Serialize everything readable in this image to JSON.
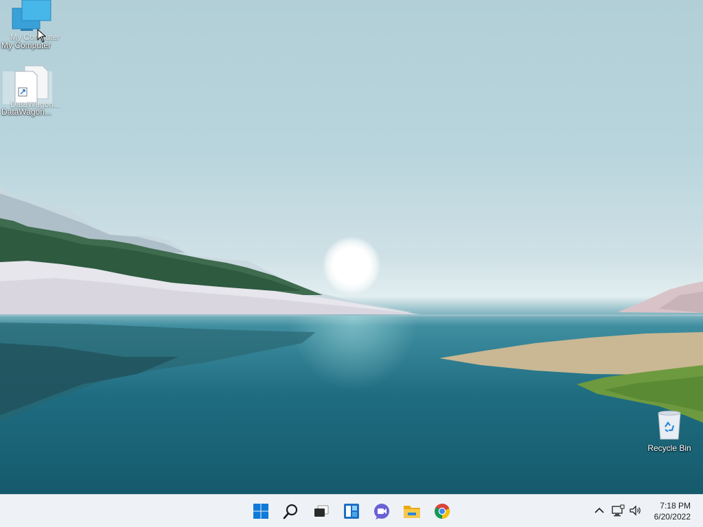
{
  "desktop": {
    "icons": [
      {
        "label": "My Computer",
        "ghost_label": "My Computer",
        "icon": "monitor-icon"
      },
      {
        "label": "DataWagon...",
        "ghost_label": "DataWagon...",
        "icon": "shortcut-file-icon"
      },
      {
        "label": "Recycle Bin",
        "icon": "recycle-bin-icon"
      }
    ]
  },
  "taskbar": {
    "apps": [
      {
        "name": "start-button",
        "icon": "windows-logo-icon"
      },
      {
        "name": "search-button",
        "icon": "search-icon"
      },
      {
        "name": "task-view-button",
        "icon": "task-view-icon"
      },
      {
        "name": "widgets-button",
        "icon": "widgets-icon"
      },
      {
        "name": "teams-chat-button",
        "icon": "video-chat-icon"
      },
      {
        "name": "file-explorer-button",
        "icon": "folder-icon"
      },
      {
        "name": "chrome-button",
        "icon": "chrome-icon"
      }
    ],
    "tray": {
      "icons": [
        "chevron-up-icon",
        "network-icon",
        "volume-icon"
      ],
      "time": "7:18 PM",
      "date": "6/20/2022"
    }
  },
  "colors": {
    "taskbar_bg": "#eef2f6",
    "windows_blue": "#0078d4",
    "folder_yellow": "#f5c242"
  }
}
